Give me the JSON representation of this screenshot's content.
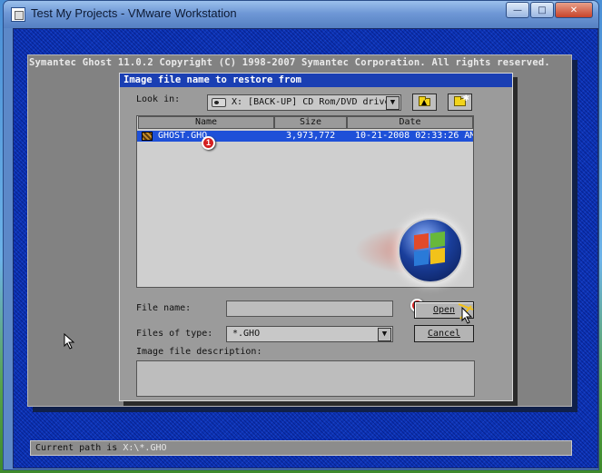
{
  "window": {
    "title": "Test My Projects - VMware Workstation",
    "minimize": "—",
    "maximize": "□",
    "close": "✕"
  },
  "ghost": {
    "header": "Symantec Ghost 11.0.2   Copyright (C) 1998-2007 Symantec Corporation. All rights reserved.",
    "status_label": "Current path is",
    "status_path": "X:\\*.GHO"
  },
  "dialog": {
    "title": "Image file name to restore from",
    "look_in_label": "Look in:",
    "look_in_value": "X: [BACK-UP] CD Rom/DVD drive",
    "columns": [
      "Name",
      "Size",
      "Date"
    ],
    "files": [
      {
        "name": "GHOST.GHO",
        "size": "3,973,772",
        "date": "10-21-2008 02:33:26 AM",
        "selected": true
      }
    ],
    "file_name_label": "File name:",
    "file_name_value": "",
    "files_of_type_label": "Files of type:",
    "files_of_type_value": "*.GHO",
    "description_label": "Image file description:",
    "description_value": "",
    "open_button": "Open",
    "cancel_button": "Cancel"
  },
  "annotations": {
    "step1": "1",
    "step2": "2"
  },
  "colors": {
    "dialog_title_bg": "#1a3fb3",
    "selected_row": "#1e50d8",
    "badge": "#d42020"
  },
  "icons": {
    "look_in_drive": "cd-drive-icon",
    "up_one_level": "folder-up-icon",
    "new_folder": "new-folder-icon",
    "file": "ghost-image-file-icon"
  }
}
